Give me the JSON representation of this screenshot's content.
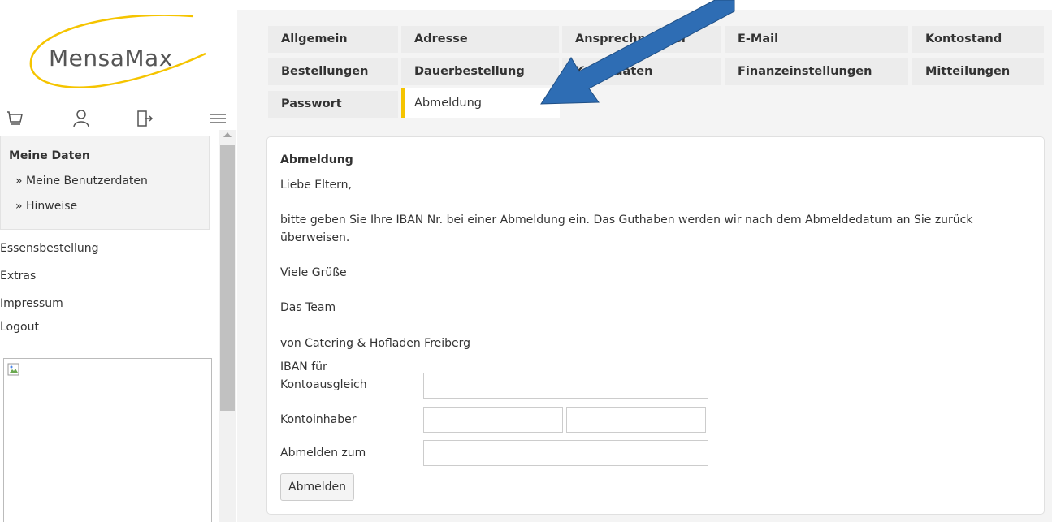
{
  "logo": {
    "text": "MensaMax"
  },
  "icons": [
    "cart-icon",
    "user-icon",
    "logout-icon",
    "menu-icon"
  ],
  "sidebar": {
    "section_title": "Meine Daten",
    "sub_items": [
      "» Meine Benutzerdaten",
      "» Hinweise"
    ],
    "items": [
      "Essensbestellung",
      "Extras",
      "Impressum",
      "Logout"
    ]
  },
  "tabs": [
    "Allgemein",
    "Adresse",
    "Ansprechpartner",
    "E-Mail",
    "Kontostand",
    "Bestellungen",
    "Dauerbestellung",
    "Kontodaten",
    "Finanzeinstellungen",
    "Mitteilungen",
    "Passwort",
    "Abmeldung"
  ],
  "active_tab": "Abmeldung",
  "form": {
    "title": "Abmeldung",
    "greeting": "Liebe Eltern,",
    "message_line1": "bitte geben Sie Ihre IBAN Nr. bei einer Abmeldung ein. Das Guthaben werden wir nach dem Abmeldedatum an Sie zurück",
    "message_line2": "überweisen.",
    "regards": "Viele Grüße",
    "team": "Das Team",
    "company": "von Catering & Hofladen Freiberg",
    "iban_label_1": "IBAN für",
    "iban_label_2": "Kontoausgleich",
    "iban_value": "",
    "holder_label": "Kontoinhaber",
    "holder_first_value": "",
    "holder_last_value": "",
    "date_label": "Abmelden zum",
    "date_value": "",
    "submit_label": "Abmelden"
  },
  "colors": {
    "accent_tab": "#f5c400",
    "logo_swoosh": "#f5c400",
    "arrow": "#2e6db4"
  }
}
